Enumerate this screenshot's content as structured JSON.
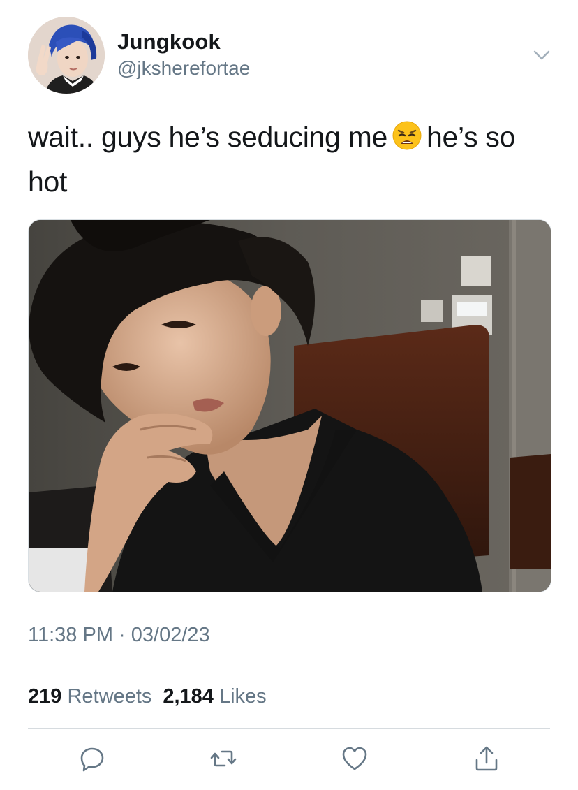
{
  "author": {
    "display_name": "Jungkook",
    "handle": "@jksherefortae",
    "avatar_icon": "profile-photo"
  },
  "tweet": {
    "text_before_emoji": "wait.. guys he’s seducing me",
    "emoji": "weary-face-emoji",
    "text_after_emoji": "he’s so hot",
    "media": "photo"
  },
  "meta": {
    "time": "11:38 PM",
    "separator": "·",
    "date": "03/02/23"
  },
  "stats": {
    "retweets_count": "219",
    "retweets_label": "Retweets",
    "likes_count": "2,184",
    "likes_label": "Likes"
  },
  "actions": {
    "reply": "reply-icon",
    "retweet": "retweet-icon",
    "like": "heart-icon",
    "share": "share-icon"
  },
  "colors": {
    "text_primary": "#14171a",
    "text_secondary": "#657786",
    "divider": "#d6dbdf"
  }
}
